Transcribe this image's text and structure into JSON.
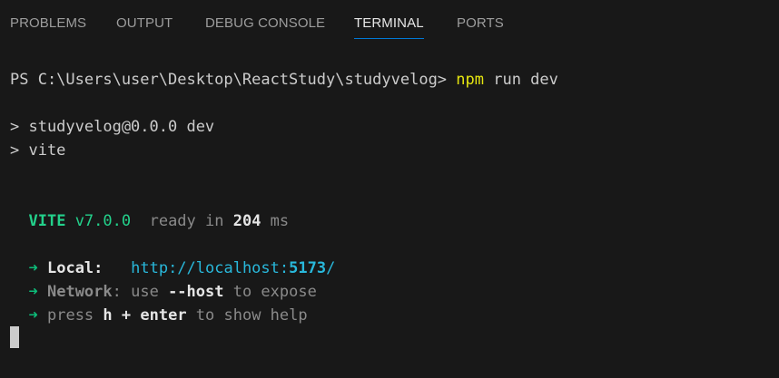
{
  "tabs": [
    {
      "label": "PROBLEMS"
    },
    {
      "label": "OUTPUT"
    },
    {
      "label": "DEBUG CONSOLE"
    },
    {
      "label": "TERMINAL",
      "active": true
    },
    {
      "label": "PORTS"
    }
  ],
  "terminal": {
    "prompt": "PS C:\\Users\\user\\Desktop\\ReactStudy\\studyvelog> ",
    "command_name": "npm",
    "command_args": " run dev",
    "script_line_1": "> studyvelog@0.0.0 dev",
    "script_line_2": "> vite",
    "vite_label": "VITE",
    "vite_version": "v7.0.0",
    "ready_text": "ready in ",
    "ready_ms": "204",
    "ready_unit": " ms",
    "arrow": "➜",
    "local_label": "Local:",
    "local_url_prefix": "http://localhost:",
    "local_port": "5173",
    "local_url_suffix": "/",
    "network_label": "Network",
    "network_text_1": ": use ",
    "network_flag": "--host",
    "network_text_2": " to expose",
    "help_text_1": "press ",
    "help_key_h": "h",
    "help_plus": " + ",
    "help_key_enter": "enter",
    "help_text_2": " to show help"
  },
  "colors": {
    "background": "#181818",
    "active_tab_underline": "#0078d4",
    "command": "#e5e510",
    "vite": "#23d18b",
    "url": "#29b8db"
  }
}
